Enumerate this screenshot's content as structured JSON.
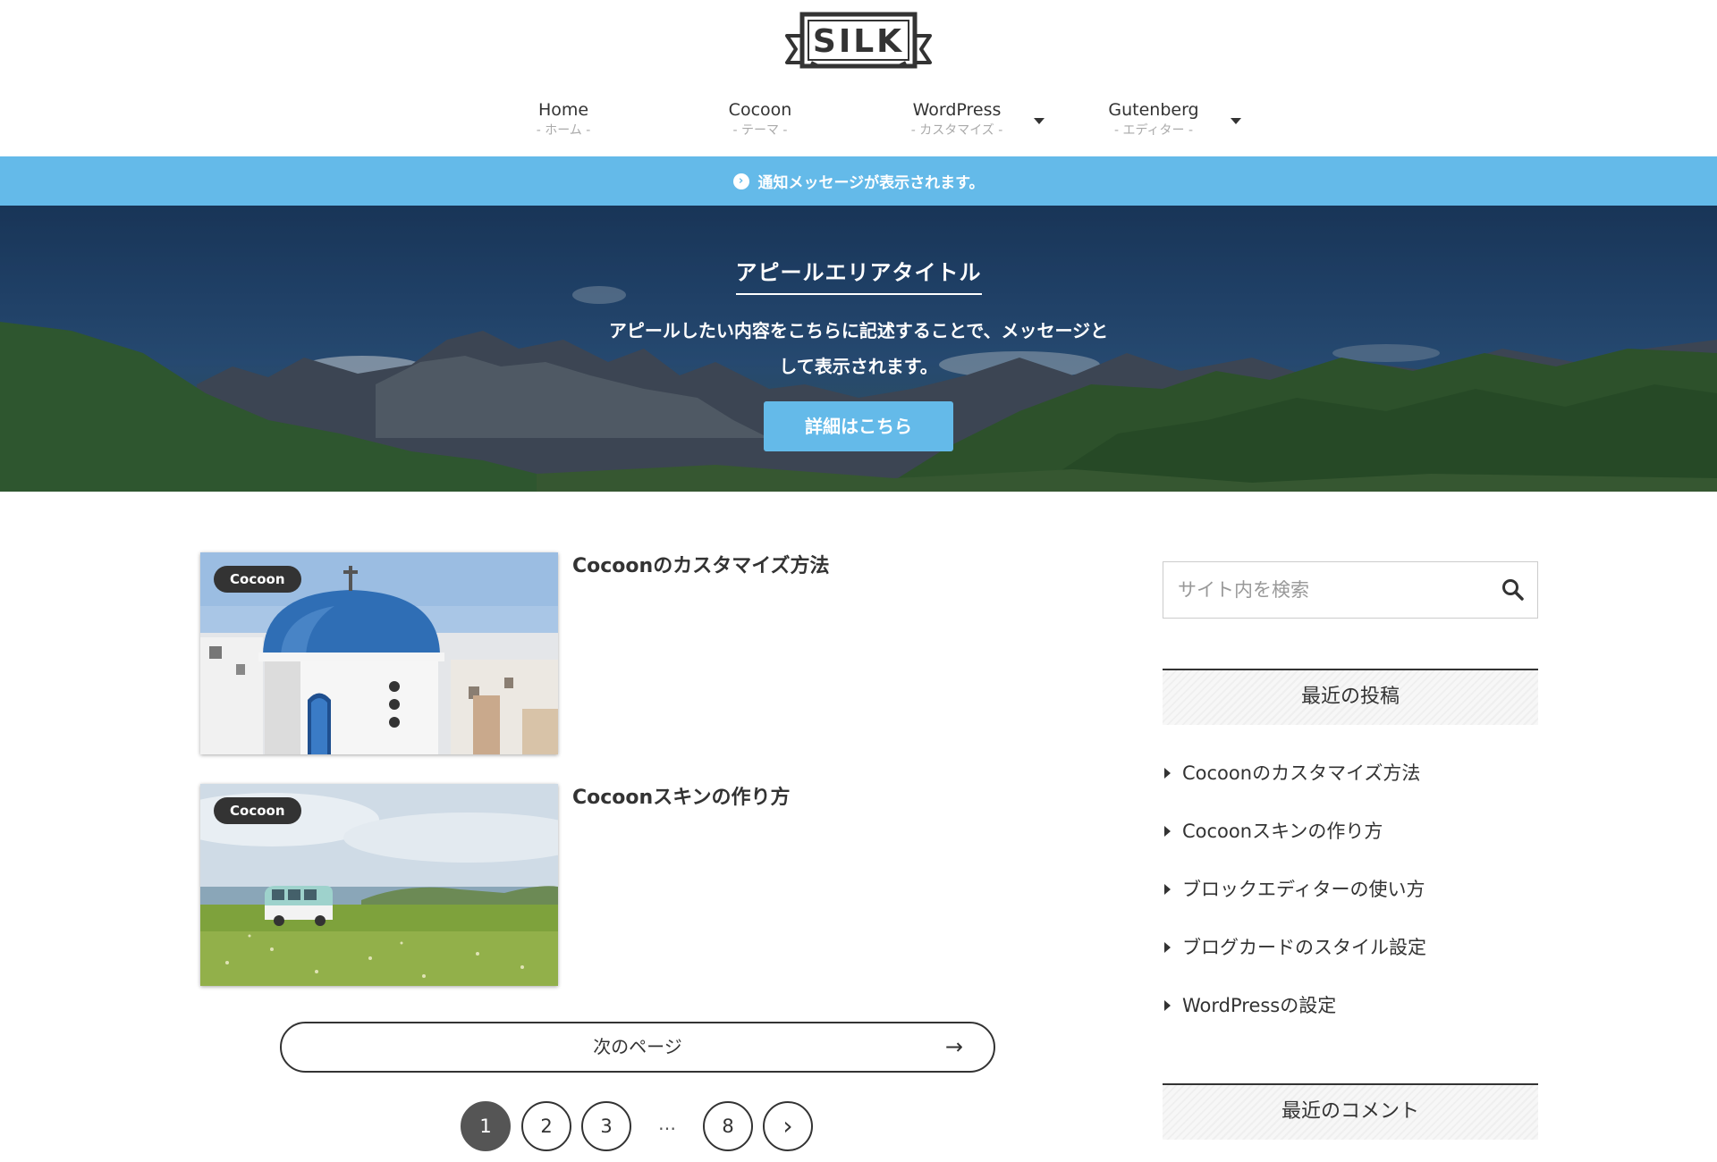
{
  "site": {
    "logo_text": "SILK"
  },
  "nav": [
    {
      "label": "Home",
      "sub": "- ホーム -",
      "has_dropdown": false
    },
    {
      "label": "Cocoon",
      "sub": "- テーマ -",
      "has_dropdown": false
    },
    {
      "label": "WordPress",
      "sub": "- カスタマイズ -",
      "has_dropdown": true
    },
    {
      "label": "Gutenberg",
      "sub": "- エディター -",
      "has_dropdown": true
    }
  ],
  "notice": {
    "icon": "arrow-circle-right-icon",
    "text": "通知メッセージが表示されます。",
    "color": "#64bae9"
  },
  "appeal": {
    "title": "アピールエリアタイトル",
    "message_line1": "アピールしたい内容をこちらに記述することで、メッセージと",
    "message_line2": "して表示されます。",
    "button_label": "詳細はこちら"
  },
  "posts": [
    {
      "category": "Cocoon",
      "title": "Cocoonのカスタマイズ方法",
      "thumb": "santorini-church"
    },
    {
      "category": "Cocoon",
      "title": "Cocoonスキンの作り方",
      "thumb": "van-meadow"
    }
  ],
  "pagination": {
    "next_label": "次のページ",
    "next_arrow": "→",
    "pages": [
      "1",
      "2",
      "3",
      "8"
    ],
    "current": "1",
    "dots": "…",
    "next_icon": "›"
  },
  "sidebar": {
    "search_placeholder": "サイト内を検索",
    "recent_posts_title": "最近の投稿",
    "recent_posts": [
      "Cocoonのカスタマイズ方法",
      "Cocoonスキンの作り方",
      "ブロックエディターの使い方",
      "ブログカードのスタイル設定",
      "WordPressの設定"
    ],
    "recent_comments_title": "最近のコメント"
  },
  "colors": {
    "accent": "#64bae9",
    "text": "#333333"
  }
}
